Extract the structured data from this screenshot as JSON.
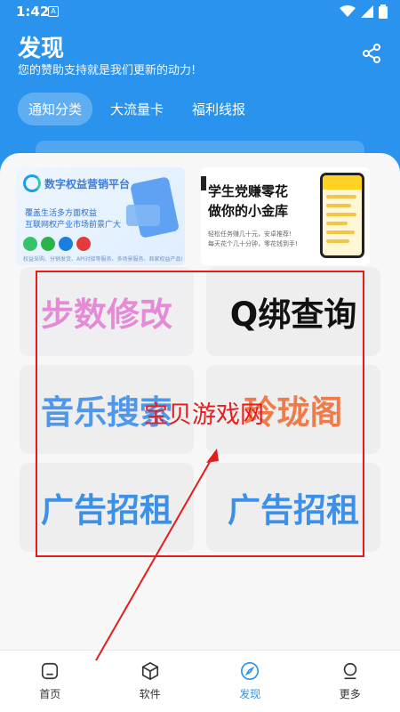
{
  "status_bar": {
    "time": "1:42",
    "notification_glyph": "A"
  },
  "header": {
    "title": "发现",
    "subtitle": "您的赞助支持就是我们更新的动力!",
    "share_icon": "share-icon"
  },
  "tabs": [
    {
      "label": "通知分类",
      "active": true
    },
    {
      "label": "大流量卡",
      "active": false
    },
    {
      "label": "福利线报",
      "active": false
    }
  ],
  "banners": {
    "left": {
      "title": "数字权益营销平台",
      "line1": "覆盖生活多方面权益",
      "line2": "互联网权产业市场前景广大",
      "footer": "权益采购、分销发货、API对接等服务、多场景服务、商家权益产品!"
    },
    "right": {
      "title_line1": "学生党赚零花",
      "title_line2": "做你的小金库",
      "sub_line1": "轻松任务赚几十元，安卓推荐!",
      "sub_line2": "每天花个几十分钟，零花钱到手!"
    }
  },
  "tiles": [
    {
      "label": "步数修改"
    },
    {
      "label": "Q绑查询"
    },
    {
      "label": "音乐搜索"
    },
    {
      "label": "玲珑阁"
    },
    {
      "label": "广告招租"
    },
    {
      "label": "广告招租"
    }
  ],
  "watermark": "宝贝游戏网",
  "nav": [
    {
      "label": "首页",
      "icon": "home-icon",
      "active": false
    },
    {
      "label": "软件",
      "icon": "cube-icon",
      "active": false
    },
    {
      "label": "发现",
      "icon": "compass-icon",
      "active": true
    },
    {
      "label": "更多",
      "icon": "user-icon",
      "active": false
    }
  ],
  "colors": {
    "primary": "#2a93ee",
    "annotation_red": "#e31c1c"
  }
}
